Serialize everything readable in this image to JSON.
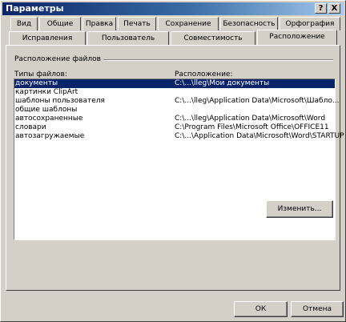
{
  "window": {
    "title": "Параметры"
  },
  "titlebar_buttons": {
    "help": "?",
    "close": "X"
  },
  "tabs_back": [
    "Вид",
    "Общие",
    "Правка",
    "Печать",
    "Сохранение",
    "Безопасность",
    "Орфография"
  ],
  "tabs_front": [
    "Исправления",
    "Пользователь",
    "Совместимость",
    "Расположение"
  ],
  "group": {
    "label": "Расположение файлов"
  },
  "columns": {
    "type": "Типы файлов:",
    "location": "Расположение:"
  },
  "rows": [
    {
      "type": "документы",
      "location": "C:\\...\\lleg\\Мои документы"
    },
    {
      "type": "картинки ClipArt",
      "location": ""
    },
    {
      "type": "шаблоны пользователя",
      "location": "C:\\...\\lleg\\Application Data\\Microsoft\\Шабло..."
    },
    {
      "type": "общие шаблоны",
      "location": ""
    },
    {
      "type": "автосохраненные",
      "location": "C:\\...\\lleg\\Application Data\\Microsoft\\Word"
    },
    {
      "type": "словари",
      "location": "C:\\Program Files\\Microsoft Office\\OFFICE11"
    },
    {
      "type": "автозагружаемые",
      "location": "C:\\...\\Application Data\\Microsoft\\Word\\STARTUP"
    }
  ],
  "buttons": {
    "modify": "Изменить...",
    "ok": "ОК",
    "cancel": "Отмена"
  }
}
